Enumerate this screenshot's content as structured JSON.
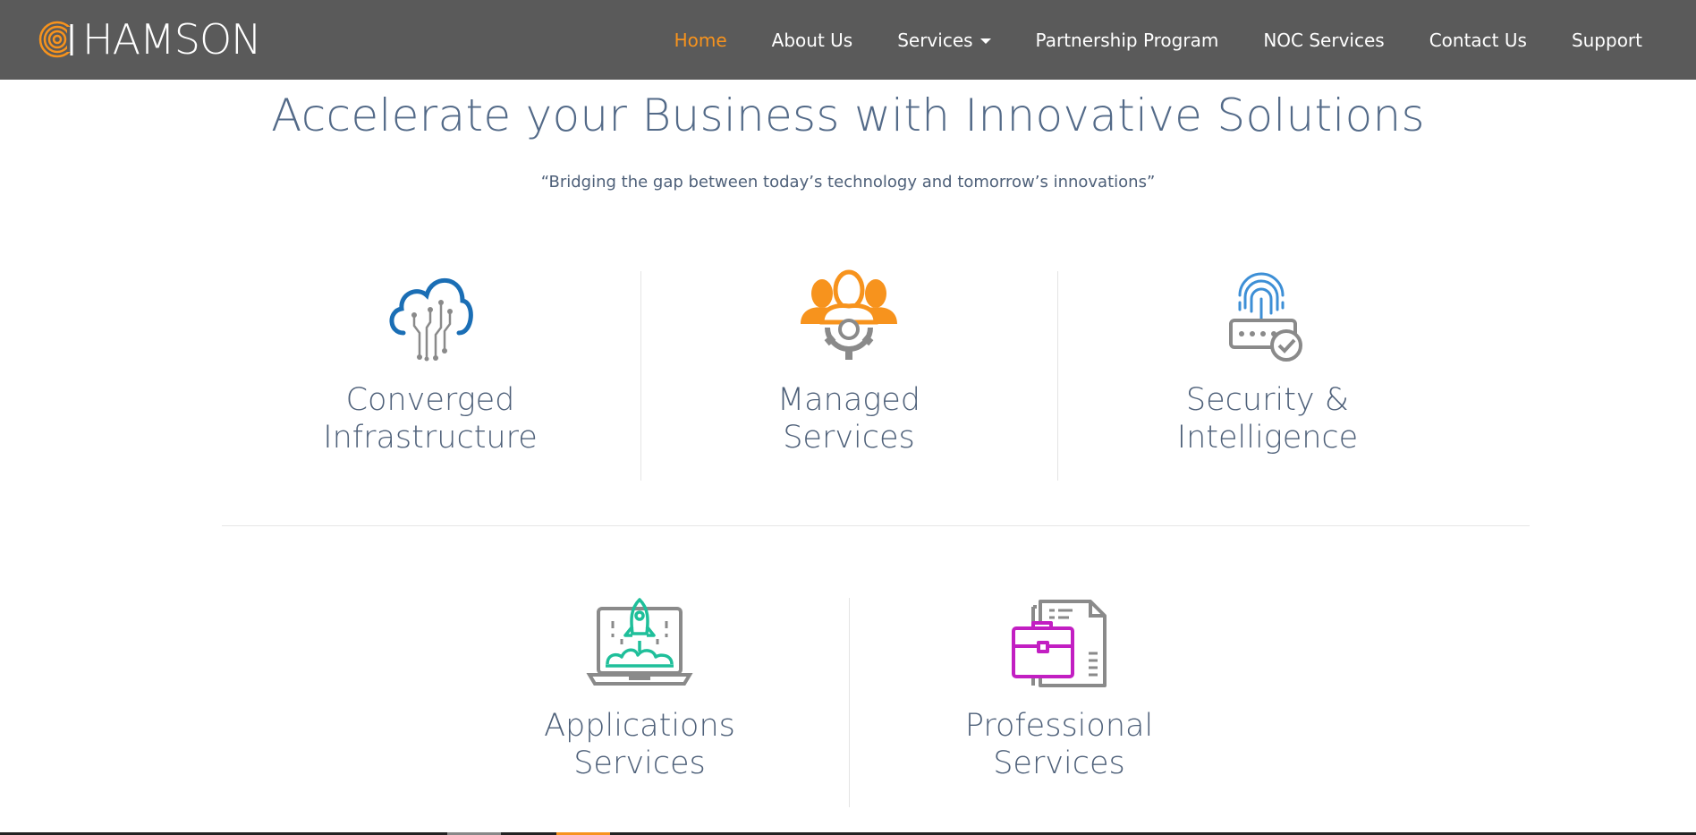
{
  "brand": {
    "name": "HAMSON",
    "logo_icon": "spiral-logo-icon",
    "accent": "#f7931d",
    "nav_bg": "#5a5a5a"
  },
  "nav": {
    "items": [
      {
        "label": "Home",
        "active": true
      },
      {
        "label": "About Us"
      },
      {
        "label": "Services",
        "dropdown": true
      },
      {
        "label": "Partnership Program"
      },
      {
        "label": "NOC Services"
      },
      {
        "label": "Contact Us"
      },
      {
        "label": "Support"
      }
    ]
  },
  "hero": {
    "title": "Accelerate your Business with Innovative Solutions",
    "subtitle": "“Bridging the gap between today’s technology and tomorrow’s innovations”"
  },
  "services": [
    {
      "line1": "Converged",
      "line2": "Infrastructure",
      "icon": "cloud-circuit-icon",
      "color": "#1a6eb5"
    },
    {
      "line1": "Managed",
      "line2": "Services",
      "icon": "team-gear-icon",
      "color": "#f7931d"
    },
    {
      "line1": "Security &",
      "line2": "Intelligence",
      "icon": "fingerprint-password-icon",
      "color": "#3d8fd6"
    },
    {
      "line1": "Applications",
      "line2": "Services",
      "icon": "laptop-rocket-icon",
      "color": "#1fbf9a"
    },
    {
      "line1": "Professional",
      "line2": "Services",
      "icon": "briefcase-document-icon",
      "color": "#c21fc2"
    }
  ]
}
